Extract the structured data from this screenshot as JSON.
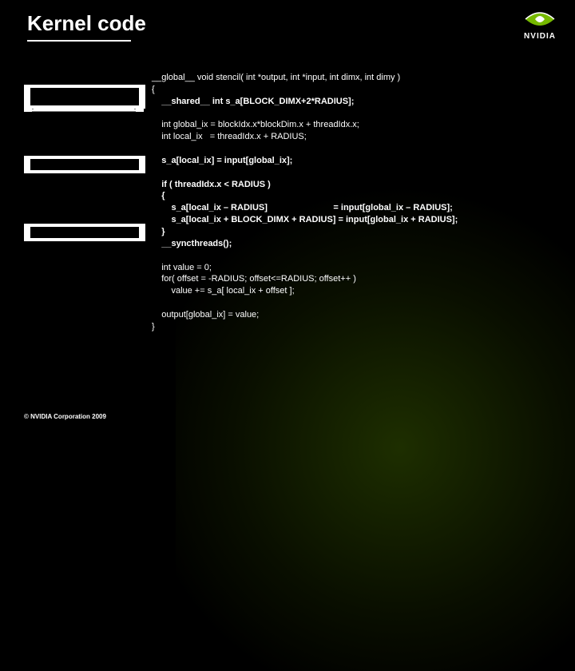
{
  "title": "Kernel code",
  "logo_text": "NVIDIA",
  "copyright": "© NVIDIA Corporation 2009",
  "code": {
    "l1": "__global__ void stencil( int *output, int *input, int dimx, int dimy )",
    "l2": "{",
    "l3": "    __shared__ int s_a[BLOCK_DIMX+2*RADIUS];",
    "l4": "",
    "l5": "    int global_ix = blockIdx.x*blockDim.x + threadIdx.x;",
    "l6": "    int local_ix   = threadIdx.x + RADIUS;",
    "l7": "",
    "l8": "    s_a[local_ix] = input[global_ix];",
    "l9": "",
    "l10": "    if ( threadIdx.x < RADIUS )",
    "l11": "    {",
    "l12": "        s_a[local_ix – RADIUS]                           = input[global_ix – RADIUS];",
    "l13": "        s_a[local_ix + BLOCK_DIMX + RADIUS] = input[global_ix + RADIUS];",
    "l14": "    }",
    "l15": "    __syncthreads();",
    "l16": "",
    "l17": "    int value = 0;",
    "l18": "    for( offset = -RADIUS; offset<=RADIUS; offset++ )",
    "l19": "        value += s_a[ local_ix + offset ];",
    "l20": "",
    "l21": "    output[global_ix] = value;",
    "l22": "}"
  }
}
